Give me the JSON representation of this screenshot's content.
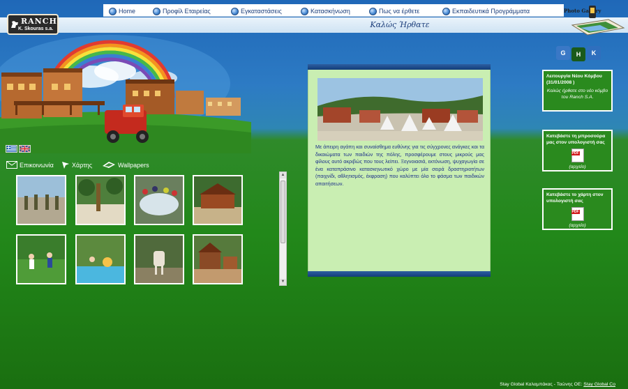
{
  "header": {
    "logo_main": "RANCH",
    "logo_sub": "K. Skouras s.a.",
    "welcome": "Καλώς Ήρθατε",
    "photo_gallery": "Photo Gallery",
    "nav": [
      {
        "id": "home",
        "label": "Home"
      },
      {
        "id": "profile",
        "label": "Προφίλ Εταιρείας"
      },
      {
        "id": "facilities",
        "label": "Εγκαταστάσεις"
      },
      {
        "id": "camping",
        "label": "Κατασκήνωση"
      },
      {
        "id": "directions",
        "label": "Πως να έρθετε"
      },
      {
        "id": "education",
        "label": "Εκπαιδευτικά Προγράμματα"
      }
    ]
  },
  "utility": {
    "contact": "Επικοινωνία",
    "map": "Χάρτης",
    "wallpapers": "Wallpapers"
  },
  "content": {
    "text": "Με άπειρη αγάπη και συναίσθημα ευθύνης για τις σύγχρονες ανάγκες και τα δικαιώματα των παιδιών της πόλης, προσφέρουμε στους μικρούς μας φίλους αυτό ακριβώς που τους λείπει. Ξεγνοιασιά, εκτόνωση, ψυχαγωγία σε ένα καταπράσινο κατασκηνωτικό χώρο με μία σειρά δραστηριοτήτων (παιχνίδι, αθλητισμός, έκφραση) που καλύπτει όλο το φάσμα των παιδικών απαιτήσεων."
  },
  "sidebar": {
    "news": {
      "title": "Λειτουργία Νέου Κόμβου (31/01/2008 )",
      "body": "Καλώς ήρθατε στο νέο κόμβο του Ranch S.A."
    },
    "brochure": {
      "title": "Κατεβάστε τη μπροσούρα μας στον υπολογιστή σας",
      "link": "(αρχείο)"
    },
    "mapdl": {
      "title": "Κατεβάστε το χάρτη στον υπολογιστή σας",
      "link": "(αρχείο)"
    }
  },
  "footer": {
    "text": "Stay Global Καλαμπάκας - Ταώνης ΟΕ:",
    "link": "Stay Global Co"
  }
}
